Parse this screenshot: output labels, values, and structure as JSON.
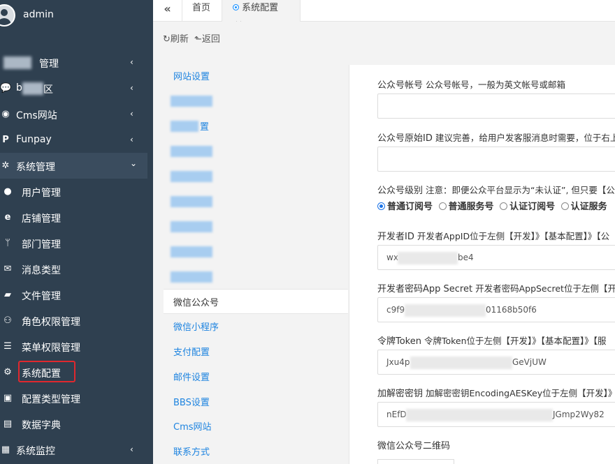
{
  "user": {
    "name": "admin"
  },
  "sidebar": {
    "items": [
      {
        "label": "管理",
        "icon": "blurred-icon",
        "chevron": "‹",
        "blurred": true
      },
      {
        "label": "区",
        "icon": "chat-icon",
        "chevron": "‹",
        "blurred": true,
        "prefix": "b"
      },
      {
        "label": "Cms网站",
        "icon": "globe-icon",
        "chevron": "‹"
      },
      {
        "label": "Funpay",
        "icon": "paypal-icon",
        "chevron": "‹"
      },
      {
        "label": "系统管理",
        "icon": "cogs-icon",
        "chevron": "⌄"
      },
      {
        "label": "用户管理",
        "icon": "user-icon"
      },
      {
        "label": "店铺管理",
        "icon": "ie-icon"
      },
      {
        "label": "部门管理",
        "icon": "branch-icon"
      },
      {
        "label": "消息类型",
        "icon": "envelope-icon"
      },
      {
        "label": "文件管理",
        "icon": "folder-icon"
      },
      {
        "label": "角色权限管理",
        "icon": "users-icon"
      },
      {
        "label": "菜单权限管理",
        "icon": "list-icon"
      },
      {
        "label": "系统配置",
        "icon": "gear-icon"
      },
      {
        "label": "配置类型管理",
        "icon": "clipboard-icon"
      },
      {
        "label": "数据字典",
        "icon": "book-icon"
      },
      {
        "label": "系统监控",
        "icon": "monitor-icon",
        "chevron": "‹"
      }
    ]
  },
  "tabs": {
    "collapse": "«",
    "home": "首页",
    "config": "系统配置",
    "close": "✕"
  },
  "toolbar": {
    "refresh": "刷新",
    "back": "返回",
    "refresh_icon": "↻",
    "back_icon": "⬑"
  },
  "leftnav": {
    "items": [
      {
        "label": "网站设置"
      },
      {
        "label": "",
        "blurred": true
      },
      {
        "label": "置",
        "blurred": true
      },
      {
        "label": "",
        "blurred": true
      },
      {
        "label": "",
        "blurred": true
      },
      {
        "label": "",
        "blurred": true
      },
      {
        "label": "",
        "blurred": true
      },
      {
        "label": "",
        "blurred": true
      },
      {
        "label": "",
        "blurred": true
      },
      {
        "label": "微信公众号",
        "active": true
      },
      {
        "label": "微信小程序"
      },
      {
        "label": "支付配置"
      },
      {
        "label": "邮件设置"
      },
      {
        "label": "BBS设置"
      },
      {
        "label": "Cms网站"
      },
      {
        "label": "联系方式"
      }
    ]
  },
  "form": {
    "account": {
      "label": "公众号帐号",
      "hint": "公众号帐号，一般为英文帐号或邮箱",
      "value": ""
    },
    "original_id": {
      "label": "公众号原始ID",
      "hint": "建议完善，给用户发客服消息时需要，位于右上方",
      "value": ""
    },
    "level": {
      "label": "公众号级别",
      "hint": "注意：即便公众平台显示为“未认证”, 但只要【公众",
      "options": [
        "普通订阅号",
        "普通服务号",
        "认证订阅号",
        "认证服务"
      ],
      "selected": 0
    },
    "app_id": {
      "label": "开发者ID",
      "hint": "开发者AppID位于左侧【开发】》【基本配置】》【公",
      "value_start": "wx",
      "value_end": "be4"
    },
    "app_secret": {
      "label": "开发者密码App Secret",
      "hint": "开发者密码AppSecret位于左侧【开发",
      "value_start": "c9f9",
      "value_end": "01168b50f6"
    },
    "token": {
      "label": "令牌Token",
      "hint": "令牌Token位于左侧【开发】》【基本配置】》【服",
      "value_start": "Jxu4p",
      "value_end": "GeVjUW"
    },
    "aes_key": {
      "label": "加解密密钥",
      "hint": "加解密密钥EncodingAESKey位于左侧【开发】》【",
      "value_start": "nEfD",
      "value_end": "JGmp2Wy82"
    },
    "qrcode": {
      "label": "微信公众号二维码"
    }
  },
  "colors": {
    "sidebar_bg": "#2f4050",
    "link_blue": "#1e84e0",
    "highlight_red": "#e0282e",
    "radio_blue": "#1a73e8"
  }
}
